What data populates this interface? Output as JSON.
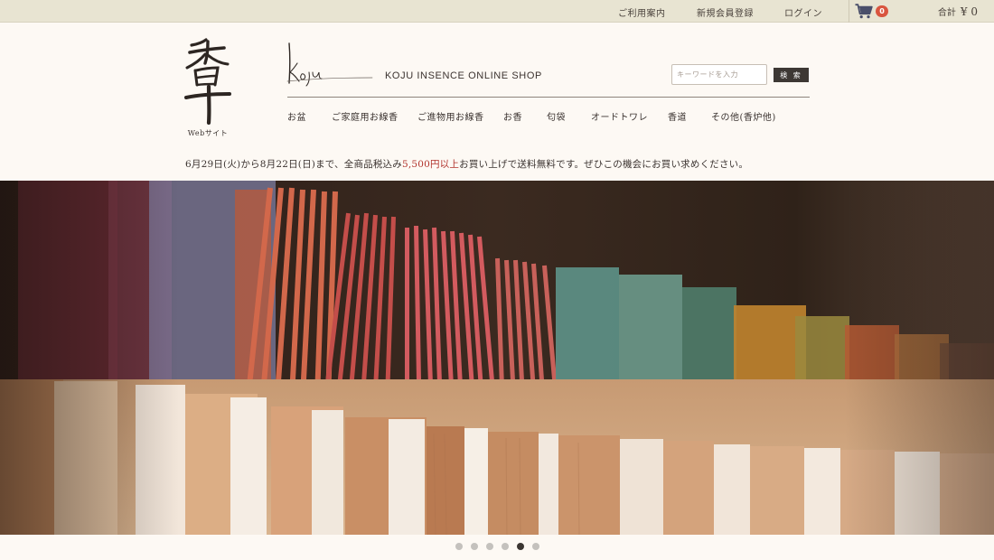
{
  "topbar": {
    "links": [
      "ご利用案内",
      "新規会員登録",
      "ログイン"
    ],
    "cart_count": "0",
    "total_label": "合計",
    "total_value": "¥ 0"
  },
  "brand": {
    "logo_text": "香十",
    "subtitle": "Webサイト"
  },
  "shop": {
    "signature": "koju",
    "title": "KOJU INSENCE ONLINE SHOP"
  },
  "search": {
    "placeholder": "キーワードを入力",
    "value": "",
    "button_label": "検 索"
  },
  "nav": [
    "お盆",
    "ご家庭用お線香",
    "ご進物用お線香",
    "お香",
    "匂袋",
    "オードトワレ",
    "香道",
    "その他(香炉他)"
  ],
  "notice": {
    "before": "6月29日(火)から8月22日(日)まで、全商品税込み",
    "highlight": "5,500円以上",
    "after": "お買い上げで送料無料です。ぜひこの機会にお買い求めください。"
  },
  "carousel": {
    "slide_count": 6,
    "active_index": 4
  },
  "colors": {
    "topbar_bg": "#e8e4d2",
    "page_bg": "#fdf9f4",
    "accent_red": "#b1322b",
    "badge_red": "#d9553f",
    "button_dark": "#3d3834"
  },
  "icons": [
    "cart-icon"
  ]
}
